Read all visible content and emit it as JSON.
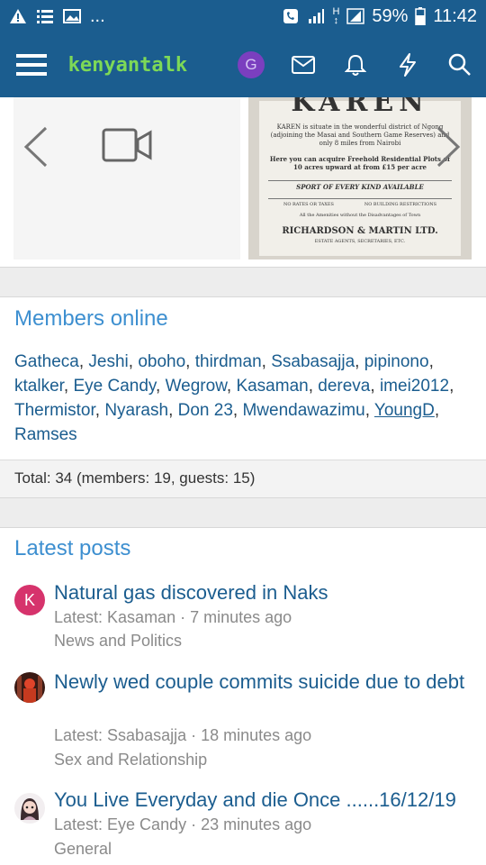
{
  "status_bar": {
    "left_more": "...",
    "network_badge": "H",
    "battery_percent": "59%",
    "time": "11:42"
  },
  "header": {
    "logo_text": "kenyantalk",
    "avatar_letter": "G",
    "icons": [
      "menu-icon",
      "mail-icon",
      "bell-icon",
      "lightning-icon",
      "search-icon"
    ]
  },
  "ad": {
    "title": "KAREN",
    "body": "KAREN is situate in the wonderful district of Ngong (adjoining the Masai and Southern Game Reserves) and only 8 miles from Nairobi",
    "offer": "Here you can acquire Freehold Residential Plots of 10 acres upward at from £15 per acre",
    "sport": "SPORT OF EVERY KIND AVAILABLE",
    "no_rates": "NO RATES OR TAXES",
    "no_restrictions": "NO BUILDING RESTRICTIONS",
    "amenities": "All the Amenities without the Disadvantages of Town",
    "firm": "RICHARDSON & MARTIN LTD.",
    "firm_sub": "ESTATE AGENTS, SECRETARIES, ETC."
  },
  "members_online": {
    "heading": "Members online",
    "names": [
      "Gatheca",
      "Jeshi",
      "oboho",
      "thirdman",
      "Ssabasajja",
      "pipinono",
      "ktalker",
      "Eye Candy",
      "Wegrow",
      "Kasaman",
      "dereva",
      "imei2012",
      "Thermistor",
      "Nyarash",
      "Don 23",
      "Mwendawazimu",
      "YoungD",
      "Ramses"
    ],
    "total": "Total: 34 (members: 19, guests: 15)"
  },
  "latest_posts": {
    "heading": "Latest posts",
    "posts": [
      {
        "avatar_letter": "K",
        "title": "Natural gas discovered in Naks",
        "meta": "Latest: Kasaman · 7 minutes ago",
        "forum": "News and Politics"
      },
      {
        "title": "Newly wed couple commits suicide due to debt",
        "meta": "Latest: Ssabasajja · 18 minutes ago",
        "forum": "Sex and Relationship"
      },
      {
        "title": "You Live Everyday and die Once ......16/12/19",
        "meta": "Latest: Eye Candy · 23 minutes ago",
        "forum": "General"
      }
    ]
  },
  "colors": {
    "primary": "#1b5d8f",
    "link": "#1b5d8f",
    "heading": "#3d8fd0",
    "logo": "#7dd957",
    "avatar_k": "#d6336c"
  }
}
